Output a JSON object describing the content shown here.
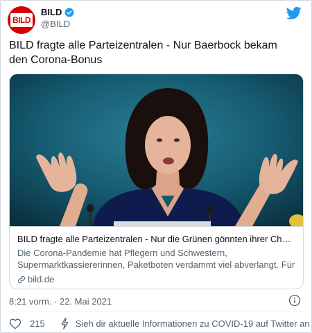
{
  "account": {
    "name": "BILD",
    "handle": "@BILD",
    "avatar_logo": "BILD",
    "verified": true
  },
  "tweet": {
    "text": "BILD fragte alle Parteizentralen - Nur Baerbock bekam\nden  Corona-Bonus"
  },
  "card": {
    "title": "BILD fragte alle Parteizentralen - Nur die Grünen gönnten ihrer Chefin...",
    "description": "Die Corona-Pandemie hat Pflegern und Schwestern,\nSupermarktkassiererinnen, Paketboten verdammt viel abverlangt. Für ...",
    "domain": "bild.de"
  },
  "meta": {
    "timestamp": "8:21 vorm. · 22. Mai 2021"
  },
  "actions": {
    "likes": "215",
    "covid_notice": "Sieh dir aktuelle Informationen zu COVID-19 auf Twitter an"
  },
  "icons": {
    "verified": "verified-badge-icon",
    "bird": "twitter-bird-icon",
    "link": "link-icon",
    "info": "info-icon",
    "heart": "heart-icon",
    "bolt": "lightning-bolt-icon"
  },
  "colors": {
    "brand_red": "#d50000",
    "twitter_blue": "#1d9bf0",
    "text_primary": "#0f1419",
    "text_secondary": "#536471",
    "border": "#cfd9de"
  }
}
